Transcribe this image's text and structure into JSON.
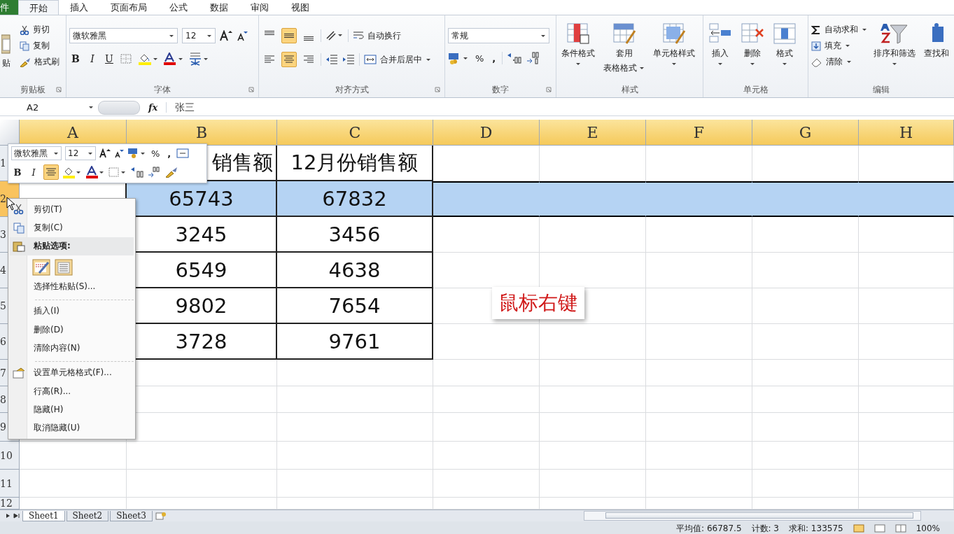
{
  "ribbon_tabs": [
    {
      "label": "件",
      "selected": false,
      "kind": "file"
    },
    {
      "label": "开始",
      "selected": true,
      "kind": "tab"
    },
    {
      "label": "插入",
      "selected": false,
      "kind": "tab"
    },
    {
      "label": "页面布局",
      "selected": false,
      "kind": "tab"
    },
    {
      "label": "公式",
      "selected": false,
      "kind": "tab"
    },
    {
      "label": "数据",
      "selected": false,
      "kind": "tab"
    },
    {
      "label": "审阅",
      "selected": false,
      "kind": "tab"
    },
    {
      "label": "视图",
      "selected": false,
      "kind": "tab"
    }
  ],
  "clipboard": {
    "paste": "贴",
    "items": [
      "剪切",
      "复制",
      "格式刷"
    ],
    "label": "剪贴板"
  },
  "font": {
    "name": "微软雅黑",
    "size": "12",
    "bold": "B",
    "italic": "I",
    "underline": "U",
    "label": "字体"
  },
  "alignment": {
    "vertical": [
      {
        "selected": false
      },
      {
        "selected": true
      },
      {
        "selected": false
      }
    ],
    "horizontal": [
      {
        "selected": false
      },
      {
        "selected": true
      },
      {
        "selected": false
      }
    ],
    "wrap": "自动换行",
    "merge": "合并后居中",
    "label": "对齐方式"
  },
  "number": {
    "format": "常规",
    "percent": "%",
    "comma": ",",
    "label": "数字"
  },
  "styles": {
    "items": [
      {
        "lines": [
          "条件格式"
        ]
      },
      {
        "lines": [
          "套用",
          "表格格式"
        ]
      },
      {
        "lines": [
          "单元格样式"
        ]
      }
    ],
    "label": "样式"
  },
  "cells": {
    "items": [
      "插入",
      "删除",
      "格式"
    ],
    "label": "单元格"
  },
  "editing": {
    "items": [
      "自动求和",
      "填充",
      "清除"
    ],
    "sort": "排序和筛选",
    "find": "查找和",
    "label": "编辑"
  },
  "formula_bar": {
    "name_box": "A2",
    "fx": "fx",
    "value": "张三"
  },
  "sheet": {
    "columns": [
      "A",
      "B",
      "C",
      "D",
      "E",
      "F",
      "G",
      "H"
    ],
    "rows": [
      {
        "header": "1",
        "selected": false,
        "b": "销售额",
        "c": "12月份销售额"
      },
      {
        "header": "2",
        "selected": true,
        "b": "65743",
        "c": "67832"
      },
      {
        "header": "3",
        "selected": false,
        "b": "3245",
        "c": "3456"
      },
      {
        "header": "4",
        "selected": false,
        "b": "6549",
        "c": "4638"
      },
      {
        "header": "5",
        "selected": false,
        "b": "9802",
        "c": "7654"
      },
      {
        "header": "6",
        "selected": false,
        "b": "3728",
        "c": "9761"
      },
      {
        "header": "7",
        "selected": false
      },
      {
        "header": "8",
        "selected": false
      },
      {
        "header": "9",
        "selected": false
      },
      {
        "header": "10",
        "selected": false
      },
      {
        "header": "11",
        "selected": false
      },
      {
        "header": "12",
        "selected": false
      }
    ]
  },
  "mini_toolbar": {
    "font": "微软雅黑",
    "size": "12",
    "percent": "%",
    "comma": ",",
    "bold": "B",
    "italic": "I",
    "center": {
      "selected": true
    }
  },
  "context_menu": [
    {
      "kind": "item",
      "label": "剪切(T)"
    },
    {
      "kind": "item",
      "label": "复制(C)"
    },
    {
      "kind": "header",
      "label": "粘贴选项:"
    },
    {
      "kind": "paste_options"
    },
    {
      "kind": "item",
      "label": "选择性粘贴(S)..."
    },
    {
      "kind": "separator"
    },
    {
      "kind": "item",
      "label": "插入(I)"
    },
    {
      "kind": "item",
      "label": "删除(D)"
    },
    {
      "kind": "item",
      "label": "清除内容(N)"
    },
    {
      "kind": "separator"
    },
    {
      "kind": "item",
      "label": "设置单元格格式(F)..."
    },
    {
      "kind": "item",
      "label": "行高(R)..."
    },
    {
      "kind": "item",
      "label": "隐藏(H)"
    },
    {
      "kind": "item",
      "label": "取消隐藏(U)"
    }
  ],
  "callout": {
    "text": "鼠标右键"
  },
  "sheet_tabs": [
    {
      "label": "Sheet1",
      "selected": true
    },
    {
      "label": "Sheet2",
      "selected": false
    },
    {
      "label": "Sheet3",
      "selected": false
    }
  ],
  "status_bar": {
    "items": [
      "平均值: 66787.5",
      "计数: 3",
      "求和: 133575"
    ],
    "zoom": "100%"
  }
}
